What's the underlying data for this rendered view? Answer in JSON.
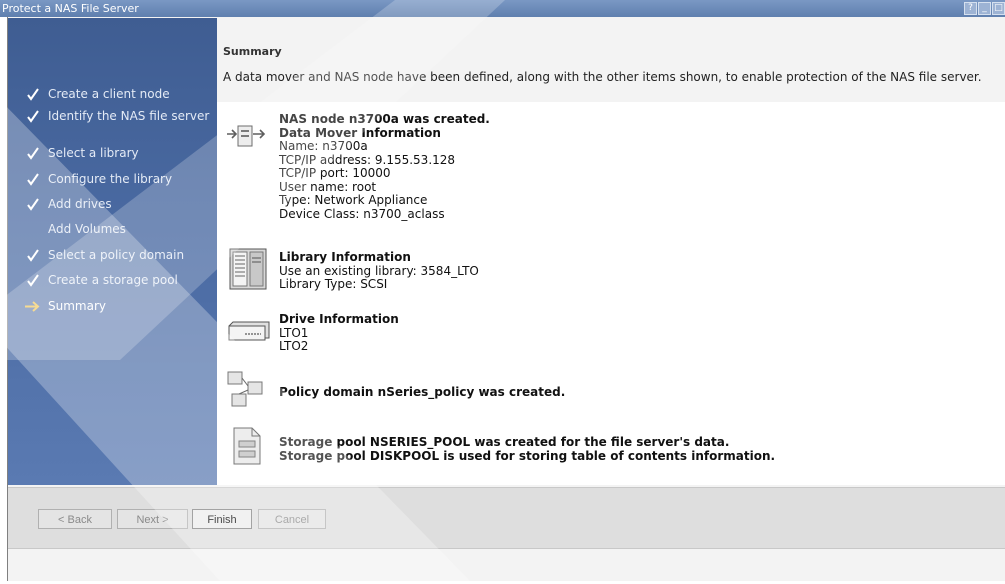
{
  "window": {
    "title": "Protect a NAS File Server",
    "controls": [
      "?",
      "_",
      "□"
    ]
  },
  "colors": {
    "title_bar": "#5f7fae",
    "steps_panel": "#4a6aa2",
    "current_arrow": "#f0c040"
  },
  "steps": [
    {
      "label": "Create a client node",
      "status": "done"
    },
    {
      "label": "Identify the NAS file server",
      "status": "done"
    },
    {
      "label": "Select a library",
      "status": "done"
    },
    {
      "label": "Configure the library",
      "status": "done"
    },
    {
      "label": "Add drives",
      "status": "done"
    },
    {
      "label": "Add Volumes",
      "status": "none"
    },
    {
      "label": "Select a policy domain",
      "status": "done"
    },
    {
      "label": "Create a storage pool",
      "status": "done"
    },
    {
      "label": "Summary",
      "status": "current"
    }
  ],
  "summary": {
    "title": "Summary",
    "intro": "A data mover and NAS node have been defined, along with the other items shown, to enable protection of the NAS file server.",
    "data_mover": {
      "icon": "data-mover-icon",
      "heading": "NAS node n3700a was created.",
      "subheading": "Data Mover Information",
      "lines": [
        "Name: n3700a",
        "TCP/IP address: 9.155.53.128",
        "TCP/IP port: 10000",
        "User name: root",
        "Type: Network Appliance",
        "Device Class: n3700_aclass"
      ]
    },
    "library": {
      "icon": "library-icon",
      "heading": "Library Information",
      "lines": [
        "Use an existing library: 3584_LTO",
        "Library Type: SCSI"
      ]
    },
    "drives": {
      "icon": "drive-icon",
      "heading": "Drive Information",
      "lines": [
        "LTO1",
        "LTO2"
      ]
    },
    "policy": {
      "icon": "policy-domain-icon",
      "text": "Policy domain nSeries_policy was created."
    },
    "storage_pool": {
      "icon": "storage-pool-icon",
      "lines": [
        "Storage pool NSERIES_POOL was created for the file server's data.",
        "Storage pool DISKPOOL is used for storing table of contents information."
      ]
    }
  },
  "buttons": {
    "back": "< Back",
    "next": "Next >",
    "finish": "Finish",
    "cancel": "Cancel"
  }
}
